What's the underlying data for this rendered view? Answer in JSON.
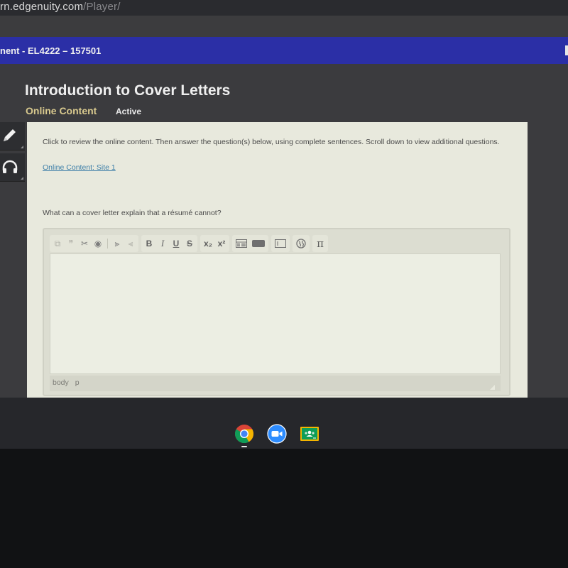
{
  "browser": {
    "url_host": "rn.edgenuity.com",
    "url_path": "/Player/"
  },
  "header": {
    "breadcrumb": "nent - EL4222 – 157501"
  },
  "page": {
    "title": "Introduction to Cover Letters",
    "section": "Online Content",
    "status": "Active"
  },
  "side_tools": [
    {
      "icon": "pencil-icon"
    },
    {
      "icon": "headphones-icon"
    }
  ],
  "content": {
    "instructions": "Click to review the online content. Then answer the question(s) below, using complete sentences. Scroll down to view additional questions.",
    "link_label": "Online Content: Site 1",
    "question": "What can a cover letter explain that a résumé cannot?"
  },
  "editor": {
    "toolbar": {
      "copy": "⧉",
      "quote": "❞",
      "cut": "✂",
      "record": "◉",
      "indent": "⫸",
      "outdent": "⫷",
      "bold": "B",
      "italic": "I",
      "underline": "U",
      "strike": "S",
      "subscript": "x₂",
      "superscript": "x²",
      "pi": "π"
    },
    "value": "",
    "status_path": [
      "body",
      "p"
    ]
  },
  "shelf": {
    "apps": [
      "Chrome",
      "Zoom",
      "Google Classroom"
    ]
  },
  "colors": {
    "header_blue": "#2b2fa6",
    "section_gold": "#d8c98e",
    "link_blue": "#3c7ea8",
    "panel_bg": "#e8e9dd"
  }
}
